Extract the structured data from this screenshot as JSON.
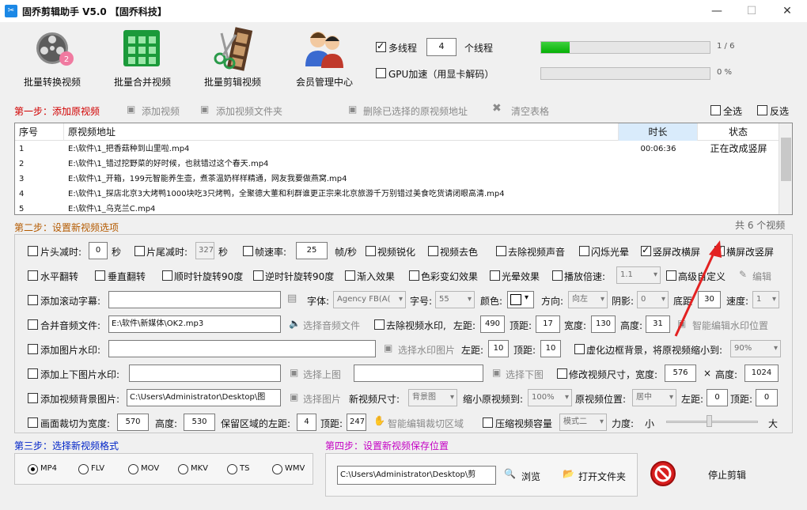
{
  "window": {
    "title": "固乔剪辑助手 V5.0 【固乔科技】",
    "controls": [
      "—",
      "☐",
      "✕"
    ]
  },
  "toolbar": {
    "items": [
      {
        "label": "批量转换视频",
        "icon": "film-reel-icon"
      },
      {
        "label": "批量合并视频",
        "icon": "merge-grid-icon"
      },
      {
        "label": "批量剪辑视频",
        "icon": "scissors-film-icon"
      },
      {
        "label": "会员管理中心",
        "icon": "users-icon"
      }
    ],
    "multithread": {
      "label": "多线程",
      "checked": true,
      "count": "4",
      "suffix": "个线程"
    },
    "gpu": {
      "label": "GPU加速（用显卡解码）",
      "checked": false
    },
    "progress1": {
      "text": "1 / 6",
      "fraction": 0.167
    },
    "progress2": {
      "text": "0 %",
      "fraction": 0
    }
  },
  "step1": {
    "label": "第一步：添加原视频",
    "actions": {
      "add_video": "添加视频",
      "add_folder": "添加视频文件夹",
      "delete_selected": "删除已选择的原视频地址",
      "clear": "清空表格"
    },
    "select_all": "全选",
    "invert": "反选"
  },
  "table": {
    "headers": {
      "index": "序号",
      "path": "原视频地址",
      "duration": "时长",
      "status": "状态"
    },
    "rows": [
      {
        "index": "1",
        "path": "E:\\软件\\1_把香菇种到山里啦.mp4",
        "duration": "00:06:36",
        "status": "正在改成竖屏"
      },
      {
        "index": "2",
        "path": "E:\\软件\\1_错过挖野菜的好时候，也就错过这个春天.mp4",
        "duration": "",
        "status": ""
      },
      {
        "index": "3",
        "path": "E:\\软件\\1_开箱，199元智能养生壶，煮茶温奶样样精通，网友我要做燕窝.mp4",
        "duration": "",
        "status": ""
      },
      {
        "index": "4",
        "path": "E:\\软件\\1_探店北京3大烤鸭1000块吃3只烤鸭，全聚德大董和利群谁更正宗来北京旅游千万别错过美食吃货请闭眼高清.mp4",
        "duration": "",
        "status": ""
      },
      {
        "index": "5",
        "path": "E:\\软件\\1_乌克兰C.mp4",
        "duration": "",
        "status": ""
      }
    ],
    "total": "共 6 个视频"
  },
  "step2": {
    "label": "第二步：设置新视频选项",
    "row1": {
      "head_cut": {
        "label": "片头减时:",
        "value": "0",
        "unit": "秒"
      },
      "tail_cut": {
        "label": "片尾减时:",
        "value": "327",
        "unit": "秒"
      },
      "fps": {
        "label": "帧速率:",
        "value": "25",
        "unit": "帧/秒"
      },
      "sharpen": "视频锐化",
      "decolor": "视频去色",
      "mute": "去除视频声音",
      "flash": "闪烁光晕",
      "v2h": "竖屏改横屏",
      "h2v": "横屏改竖屏"
    },
    "row2": {
      "hflip": "水平翻转",
      "vflip": "垂直翻转",
      "cw90": "顺时针旋转90度",
      "ccw90": "逆时针旋转90度",
      "fade": "渐入效果",
      "color_shift": "色彩变幻效果",
      "glow": "光晕效果",
      "speed": {
        "label": "播放倍速:",
        "value": "1.1"
      },
      "custom": "高级自定义",
      "edit": "编辑"
    },
    "row3": {
      "subtitle": "添加滚动字幕:",
      "font_label": "字体:",
      "font_value": "Agency FB(A(",
      "size_label": "字号:",
      "size_value": "55",
      "color_label": "颜色:",
      "dir_label": "方向:",
      "dir_value": "向左",
      "shadow_label": "阴影:",
      "shadow_value": "0",
      "bottom_label": "底距",
      "bottom_value": "30",
      "speed_label": "速度:",
      "speed_value": "1"
    },
    "row4": {
      "merge_audio": "合并音频文件:",
      "audio_path": "E:\\软件\\新媒体\\OK2.mp3",
      "choose_audio": "选择音频文件",
      "remove_wm": "去除视频水印,",
      "left_label": "左距:",
      "left": "490",
      "top_label": "顶距:",
      "top": "17",
      "width_label": "宽度:",
      "width": "130",
      "height_label": "高度:",
      "height": "31",
      "smart": "智能编辑水印位置"
    },
    "row5": {
      "image_wm": "添加图片水印:",
      "choose_wm": "选择水印图片",
      "left_label": "左距:",
      "left": "10",
      "top_label": "顶距:",
      "top": "10",
      "blur": "虚化边框背景，将原视频缩小到:",
      "blur_value": "90%"
    },
    "row6": {
      "updown": "添加上下图片水印:",
      "choose_up": "选择上图",
      "choose_down": "选择下图",
      "resize": "修改视频尺寸，",
      "width_label": "宽度:",
      "width": "576",
      "times": "×",
      "height_label": "高度:",
      "height": "1024"
    },
    "row7": {
      "bg": "添加视频背景图片:",
      "bg_path": "C:\\Users\\Administrator\\Desktop\\图",
      "choose_img": "选择图片",
      "new_size_label": "新视频尺寸:",
      "new_size": "背景图",
      "shrink_label": "缩小原视频到:",
      "shrink": "100%",
      "pos_label": "原视频位置:",
      "pos": "居中",
      "left_label": "左距:",
      "left": "0",
      "top_label": "顶距:",
      "top": "0"
    },
    "row8": {
      "crop": "画面裁切为宽度:",
      "width": "570",
      "height_label": "高度:",
      "height": "530",
      "keep_left_label": "保留区域的左距:",
      "keep_left": "4",
      "top_label": "顶距:",
      "top": "247",
      "smart_crop": "智能编辑裁切区域",
      "compress": "压缩视频容量",
      "mode": "模式二",
      "force_label": "力度:",
      "small": "小",
      "big": "大",
      "force_level": 0.5
    }
  },
  "step3": {
    "label": "第三步：选择新视频格式",
    "formats": [
      "MP4",
      "FLV",
      "MOV",
      "MKV",
      "TS",
      "WMV"
    ],
    "selected": "MP4"
  },
  "step4": {
    "label": "第四步：设置新视频保存位置",
    "path": "C:\\Users\\Administrator\\Desktop\\剪",
    "browse": "浏览",
    "open": "打开文件夹"
  },
  "stop": "停止剪辑",
  "colors": {
    "accent_red": "#d10000",
    "accent_blue": "#0024c8",
    "accent_purple": "#c400c4",
    "progress_green": "#1fc11f"
  }
}
